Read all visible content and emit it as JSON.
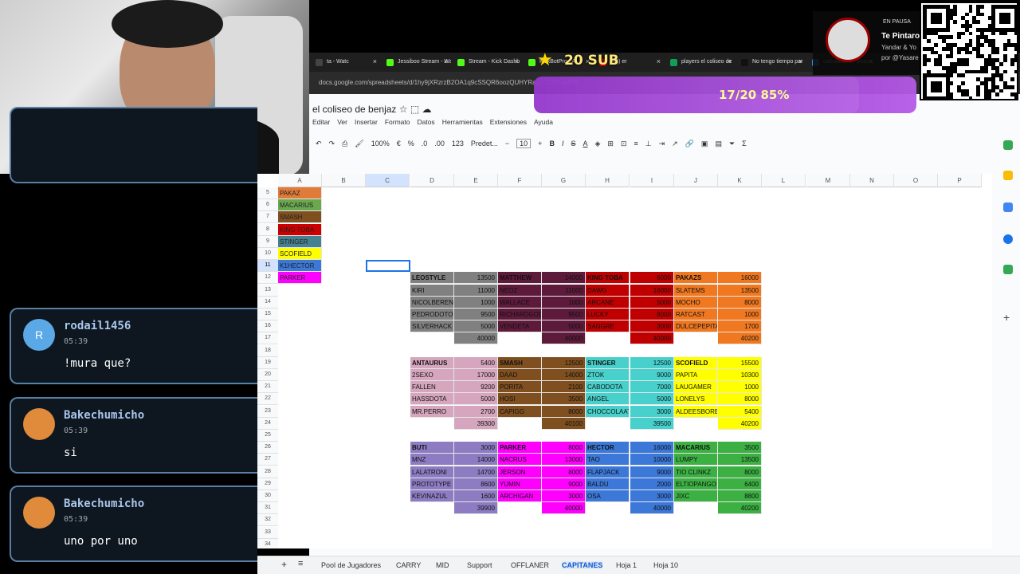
{
  "browser": {
    "tabs": [
      {
        "label": "ta - Watc",
        "color": "#444"
      },
      {
        "label": "Jessiboo Stream - Wa",
        "color": "#53fc18"
      },
      {
        "label": "Stream - Kick Dashb",
        "color": "#53fc18"
      },
      {
        "label": "KickBotPro - A",
        "color": "#53fc18"
      },
      {
        "label": "(42) er",
        "color": "#e00"
      },
      {
        "label": "players el coliseo de",
        "color": "#0f9d58"
      },
      {
        "label": "No tengo tiempo par",
        "color": "#111"
      },
      {
        "label": "calculadora - Busca",
        "color": "#4285f4"
      }
    ],
    "url": "docs.google.com/spreadsheets/d/1hy9jXRzrzB2OA1q9cSSQR6oozQUHYRagcCXHCaafH5"
  },
  "sheet": {
    "title": "el coliseo de benjaz",
    "menus": [
      "Editar",
      "Ver",
      "Insertar",
      "Formato",
      "Datos",
      "Herramientas",
      "Extensiones",
      "Ayuda"
    ],
    "zoom": "100%",
    "font": "Predet...",
    "font_size": "10",
    "toolbar_text": [
      "€",
      "%",
      ".0",
      ".00",
      "123"
    ],
    "columns": [
      "A",
      "B",
      "C",
      "D",
      "E",
      "F",
      "G",
      "H",
      "I",
      "J",
      "K",
      "L",
      "M",
      "N",
      "O",
      "P"
    ],
    "selected_column": "C",
    "selected_row": "11",
    "rows": [
      "5",
      "6",
      "7",
      "8",
      "9",
      "10",
      "11",
      "12",
      "13",
      "14",
      "15",
      "16",
      "17",
      "18",
      "19",
      "20",
      "21",
      "22",
      "23",
      "24",
      "25",
      "26",
      "27",
      "28",
      "29",
      "30",
      "31",
      "32",
      "33",
      "34"
    ],
    "captains": [
      {
        "name": "PAKAZ",
        "color": "#e07b39"
      },
      {
        "name": "MACARIUS",
        "color": "#6aa84f"
      },
      {
        "name": "SMASH",
        "color": "#7f4f1f"
      },
      {
        "name": "KING TOBA",
        "color": "#cc0000"
      },
      {
        "name": "STINGER",
        "color": "#45818e"
      },
      {
        "name": "SCOFIELD",
        "color": "#ffff00"
      },
      {
        "name": "K1HECTOR",
        "color": "#3c78d8"
      },
      {
        "name": "PARKER",
        "color": "#ff00ff"
      }
    ],
    "teams": [
      {
        "captain": "LEOSTYLE",
        "value": "13500",
        "color": "#808080",
        "players": [
          [
            "KIRI",
            "11000"
          ],
          [
            "NICOLBERENICE",
            "1000"
          ],
          [
            "PEDRODOTO",
            "9500"
          ],
          [
            "SILVERHACK",
            "5000"
          ]
        ],
        "total": "40000"
      },
      {
        "captain": "MATTHEW",
        "value": "14000",
        "color": "#5e1a3a",
        "players": [
          [
            "NEOZ",
            "11000"
          ],
          [
            "WALLACE",
            "1000"
          ],
          [
            "RICHARDGOD",
            "9500"
          ],
          [
            "VENDETA",
            "5000"
          ]
        ],
        "total": "40000"
      },
      {
        "captain": "KING TOBA",
        "value": "6000",
        "color": "#c00000",
        "players": [
          [
            "DAWG",
            "16000"
          ],
          [
            "ARCANE",
            "5000"
          ],
          [
            "LUCKY",
            "8000"
          ],
          [
            "SANGRE",
            "3000"
          ]
        ],
        "total": "40000"
      },
      {
        "captain": "PAKAZS",
        "value": "16000",
        "color": "#f07820",
        "players": [
          [
            "SLATEMS",
            "13500"
          ],
          [
            "MOCHO",
            "8000"
          ],
          [
            "RATCAST",
            "1000"
          ],
          [
            "DULCEPEPITA",
            "1700"
          ]
        ],
        "total": "40200"
      },
      {
        "captain": "ANTAURUS",
        "value": "5400",
        "color": "#d5a6bd",
        "players": [
          [
            "2SEXO",
            "17000"
          ],
          [
            "FALLEN",
            "9200"
          ],
          [
            "HASSDOTA",
            "5000"
          ],
          [
            "MR.PERRO",
            "2700"
          ]
        ],
        "total": "39300"
      },
      {
        "captain": "SMASH",
        "value": "12500",
        "color": "#7f4f1f",
        "players": [
          [
            "DAAD",
            "14000"
          ],
          [
            "PORITA",
            "2100"
          ],
          [
            "HOSI",
            "3500"
          ],
          [
            "CAPIGG",
            "8000"
          ]
        ],
        "total": "40100"
      },
      {
        "captain": "STINGER",
        "value": "12500",
        "color": "#48d1cc",
        "players": [
          [
            "ZTOK",
            "9000"
          ],
          [
            "CABODOTA",
            "7000"
          ],
          [
            "ANGEL",
            "5000"
          ],
          [
            "CHOCCOLAATE",
            "3000"
          ]
        ],
        "total": "39500"
      },
      {
        "captain": "SCOFIELD",
        "value": "15500",
        "color": "#ffff00",
        "players": [
          [
            "PAPITA",
            "10300"
          ],
          [
            "LAUGAMER",
            "1000"
          ],
          [
            "LONELYS",
            "8000"
          ],
          [
            "ALDEESBORED",
            "5400"
          ]
        ],
        "total": "40200"
      },
      {
        "captain": "BUTI",
        "value": "3000",
        "color": "#8e7cc3",
        "players": [
          [
            "MNZ",
            "14000"
          ],
          [
            "LALATRONI",
            "14700"
          ],
          [
            "PROTOTYPE",
            "8600"
          ],
          [
            "KEVINAZUL",
            "1600"
          ]
        ],
        "total": "39900"
      },
      {
        "captain": "PARKER",
        "value": "8000",
        "color": "#ff00ff",
        "players": [
          [
            "NACRUS",
            "13000"
          ],
          [
            "JERSON",
            "8000"
          ],
          [
            "YUMIN",
            "9000"
          ],
          [
            "ARCHIGAN",
            "3000"
          ]
        ],
        "total": "40000"
      },
      {
        "captain": "HECTOR",
        "value": "16000",
        "color": "#3c78d8",
        "players": [
          [
            "TAO",
            "10000"
          ],
          [
            "FLAPJACK",
            "9000"
          ],
          [
            "BALDU",
            "2000"
          ],
          [
            "OSA",
            "3000"
          ]
        ],
        "total": "40000"
      },
      {
        "captain": "MACARIUS",
        "value": "3500",
        "color": "#3cb043",
        "players": [
          [
            "LUMPY",
            "13500"
          ],
          [
            "TIO CLINKZ",
            "8000"
          ],
          [
            "ELTIOPANGO",
            "6400"
          ],
          [
            "JIXC",
            "8800"
          ]
        ],
        "total": "40200"
      }
    ],
    "sheet_tabs": [
      "Pool de Jugadores",
      "CARRY",
      "MID",
      "Support",
      "OFFLANER",
      "CAPITANES",
      "Hoja 1",
      "Hoja 10"
    ],
    "active_tab": "CAPITANES"
  },
  "chat": [
    {
      "user": "rodail1456",
      "time": "05:39",
      "text": "!mura que?",
      "avatar": "R",
      "avatar_color": "#5aa9e6"
    },
    {
      "user": "Bakechumicho",
      "time": "05:39",
      "text": "si",
      "avatar": "",
      "avatar_color": "#e08a3c"
    },
    {
      "user": "Bakechumicho",
      "time": "05:39",
      "text": "uno por uno",
      "avatar": "",
      "avatar_color": "#e08a3c"
    }
  ],
  "overlay": {
    "sub_goal_title": "20 SUB",
    "sub_goal_progress": "17/20 85%",
    "progress_fraction": 0.85,
    "music_status": "EN PAUSA",
    "music_title": "Te Pintaro",
    "music_artist": "Yandar & Yo",
    "music_handle": "por @Yasare"
  }
}
